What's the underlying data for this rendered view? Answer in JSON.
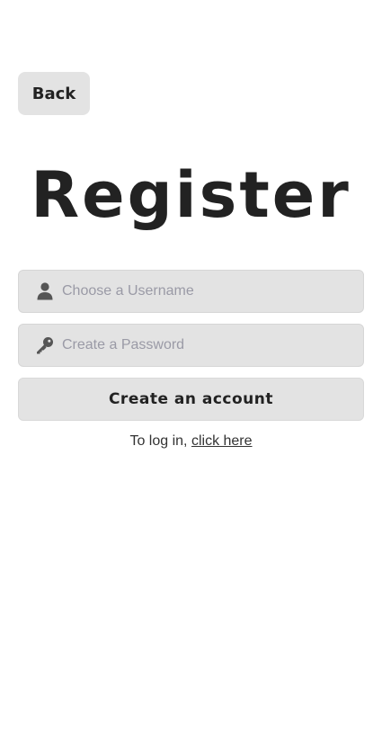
{
  "back_button": {
    "label": "Back"
  },
  "title": "Register",
  "username_field": {
    "placeholder": "Choose a Username",
    "value": "",
    "icon": "user-icon"
  },
  "password_field": {
    "placeholder": "Create a Password",
    "value": "",
    "icon": "key-icon"
  },
  "create_button": {
    "label": "Create an account"
  },
  "login_prompt": {
    "text": "To log in,",
    "link_label": "click here"
  },
  "colors": {
    "field_bg": "#e3e3e3",
    "text": "#222222",
    "placeholder": "#9a9aa6",
    "icon": "#555555"
  }
}
